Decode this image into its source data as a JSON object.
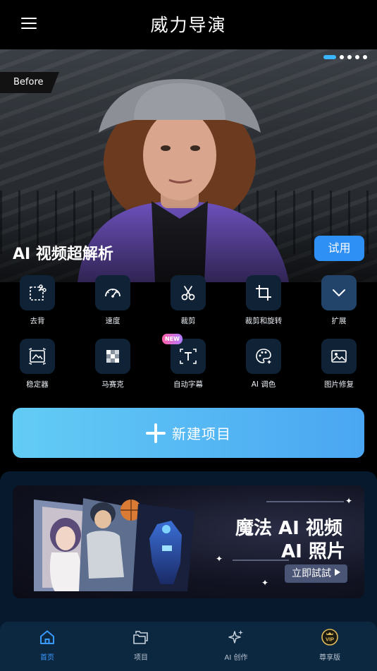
{
  "header": {
    "title": "威力导演"
  },
  "hero": {
    "before_label": "Before",
    "caption": "AI 视频超解析",
    "try_label": "试用",
    "pages": 5,
    "active_page": 1
  },
  "tools": [
    {
      "label": "去背",
      "icon": "cutout-icon"
    },
    {
      "label": "速度",
      "icon": "speedometer-icon"
    },
    {
      "label": "裁剪",
      "icon": "scissors-icon"
    },
    {
      "label": "裁剪和旋转",
      "icon": "crop-rotate-icon"
    },
    {
      "label": "扩展",
      "icon": "chevron-down-icon"
    },
    {
      "label": "稳定器",
      "icon": "stabilizer-icon"
    },
    {
      "label": "马赛克",
      "icon": "mosaic-icon"
    },
    {
      "label": "自动字幕",
      "icon": "auto-caption-icon",
      "badge": "NEW"
    },
    {
      "label": "AI 调色",
      "icon": "palette-icon"
    },
    {
      "label": "图片修复",
      "icon": "image-repair-icon"
    }
  ],
  "new_project": {
    "label": "新建项目"
  },
  "banner": {
    "line1": "魔法 AI 视频",
    "line2": "AI 照片",
    "cta": "立即試試"
  },
  "tabbar": [
    {
      "label": "首页",
      "icon": "home-icon",
      "active": true
    },
    {
      "label": "项目",
      "icon": "folder-icon",
      "active": false
    },
    {
      "label": "AI 创作",
      "icon": "sparkle-icon",
      "active": false
    },
    {
      "label": "尊享版",
      "icon": "vip-icon",
      "active": false
    }
  ],
  "colors": {
    "accent": "#3a9bff",
    "try_button": "#2e8ff5",
    "tool_tile": "#0f2236",
    "tabbar_bg": "#0c2740"
  }
}
